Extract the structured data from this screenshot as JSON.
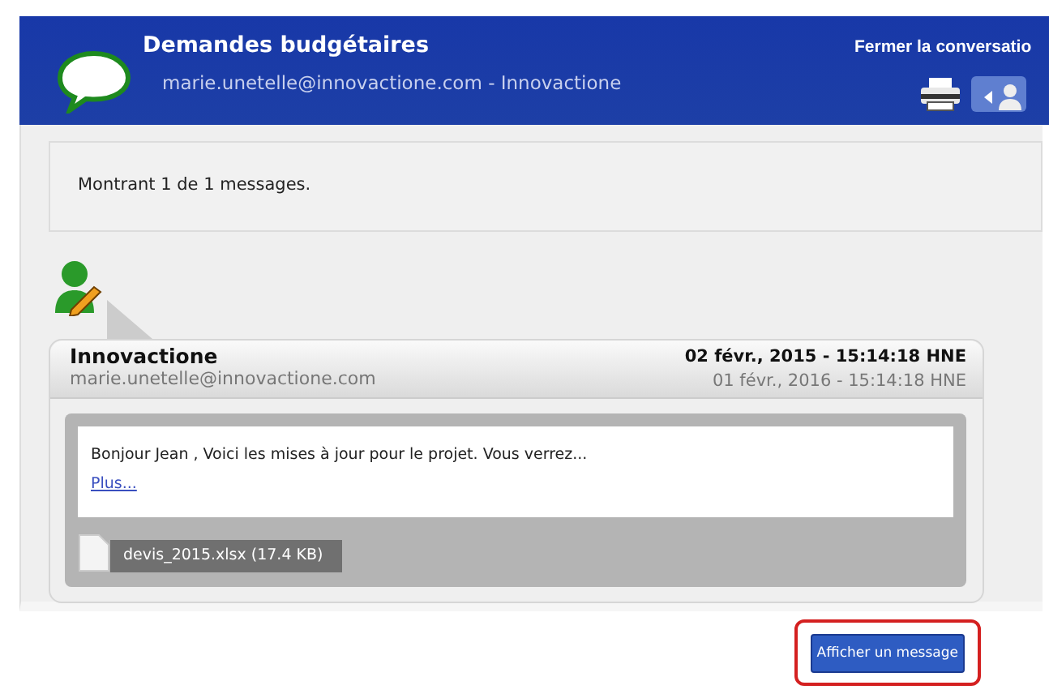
{
  "header": {
    "title": "Demandes budgétaires",
    "subtitle": "marie.unetelle@innovactione.com - Innovactione",
    "close_link": "Fermer la conversatio"
  },
  "summary": "Montrant 1 de 1 messages.",
  "messages": [
    {
      "sender": "Innovactione",
      "email": "marie.unetelle@innovactione.com",
      "date": "02 févr., 2015 - 15:14:18 HNE",
      "date_2": "01 févr., 2016 - 15:14:18 HNE",
      "preview": "Bonjour Jean , Voici les mises à jour pour le projet. Vous verrez...",
      "more_link": "Plus...",
      "attachments": [
        {
          "label": "devis_2015.xlsx (17.4 KB)"
        }
      ]
    }
  ],
  "action_button": {
    "label": "Afficher un message",
    "highlighted": true
  }
}
